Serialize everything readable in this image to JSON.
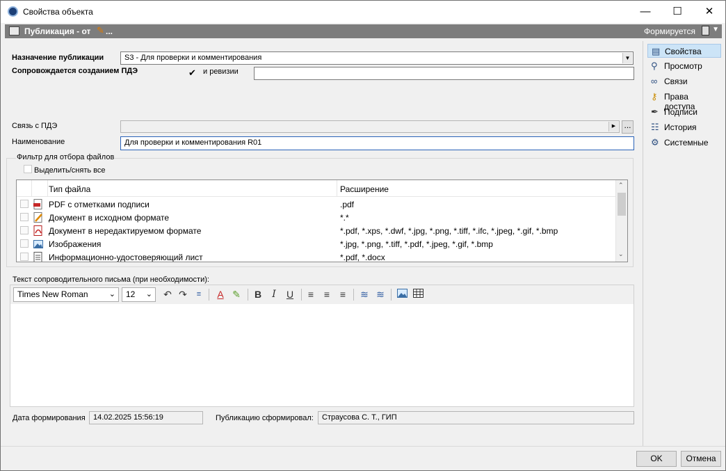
{
  "window": {
    "title": "Свойства объекта",
    "minimize_icon": "minimize-icon",
    "maximize_icon": "maximize-icon",
    "close_icon": "close-icon"
  },
  "header": {
    "title": "Публикация - от",
    "ellipsis": "...",
    "status": "Формируется"
  },
  "form": {
    "purpose_label": "Назначение публикации",
    "purpose_value": "S3 - Для проверки и комментирования",
    "pde_label": "Сопровождается созданием ПДЭ",
    "pde_checked": true,
    "revision_label": "и ревизии",
    "revision_value": "",
    "pde_link_label": "Связь с ПДЭ",
    "pde_link_value": "",
    "pde_link_btn": "...",
    "name_label": "Наименование",
    "name_value": "Для проверки и комментирования R01"
  },
  "filter": {
    "title": "Фильтр для отбора файлов",
    "select_all_label": "Выделить/снять все",
    "columns": [
      "Тип файла",
      "Расширение"
    ],
    "rows": [
      {
        "type": "PDF с отметками подписи",
        "ext": ".pdf",
        "icon": "pdf-sign-icon"
      },
      {
        "type": "Документ в исходном формате",
        "ext": "*.*",
        "icon": "doc-edit-icon"
      },
      {
        "type": "Документ в нередактируемом формате",
        "ext": "*.pdf, *.xps, *.dwf, *.jpg, *.png, *.tiff, *.ifc,  *.jpeg, *.gif, *.bmp",
        "icon": "pdf-icon"
      },
      {
        "type": "Изображения",
        "ext": "*.jpg, *.png, *.tiff, *.pdf,  *.jpeg, *.gif, *.bmp",
        "icon": "image-icon"
      },
      {
        "type": "Информационно-удостоверяющий лист",
        "ext": "*.pdf, *.docx",
        "icon": "document-icon"
      }
    ]
  },
  "letter": {
    "label": "Текст сопроводительного письма (при необходимости):",
    "font": "Times New Roman",
    "size": "12"
  },
  "footer": {
    "date_label": "Дата формирования",
    "date_value": "14.02.2025 15:56:19",
    "author_label": "Публикацию сформировал:",
    "author_value": "Страусова С. Т., ГИП",
    "ok": "OK",
    "cancel": "Отмена"
  },
  "sidebar": {
    "items": [
      {
        "label": "Свойства",
        "icon": "properties-icon",
        "selected": true
      },
      {
        "label": "Просмотр",
        "icon": "magnifier-icon"
      },
      {
        "label": "Связи",
        "icon": "link-icon"
      },
      {
        "label": "Права доступа",
        "icon": "keys-icon"
      },
      {
        "label": "Подписи",
        "icon": "pen-icon"
      },
      {
        "label": "История",
        "icon": "history-icon"
      },
      {
        "label": "Системные",
        "icon": "system-icon"
      }
    ]
  },
  "colors": {
    "header_bg": "#7d7d7d",
    "selection": "#cce4f7"
  }
}
